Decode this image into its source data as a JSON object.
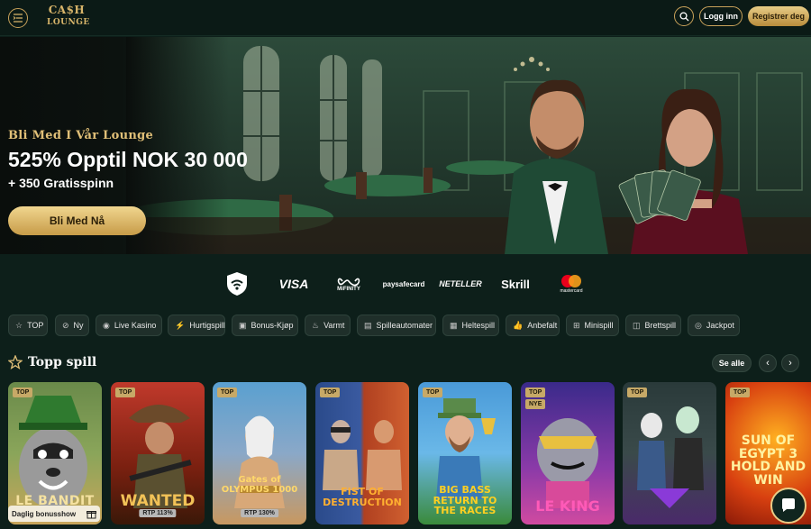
{
  "header": {
    "logo_line1": "CA$H",
    "logo_line2": "LOUNGE",
    "login_label": "Logg inn",
    "register_label": "Registrer deg"
  },
  "hero": {
    "eyebrow": "Bli Med I Vår Lounge",
    "title": "525% Opptil NOK 30 000",
    "subtitle": "+ 350 Gratisspinn",
    "cta_label": "Bli Med Nå",
    "slide_count": 3,
    "active_slide": 1
  },
  "payments": [
    "VISA",
    "MiFINITY",
    "paysafecard",
    "NETELLER",
    "Skrill",
    "mastercard"
  ],
  "categories": [
    {
      "label": "TOP",
      "icon": "star-icon"
    },
    {
      "label": "Ny",
      "icon": "new-icon"
    },
    {
      "label": "Live Kasino",
      "icon": "live-icon"
    },
    {
      "label": "Hurtigspill",
      "icon": "bolt-icon"
    },
    {
      "label": "Bonus-Kjøp",
      "icon": "gift-icon"
    },
    {
      "label": "Varmt",
      "icon": "flame-icon"
    },
    {
      "label": "Spilleautomater",
      "icon": "slot-icon"
    },
    {
      "label": "Heltespill",
      "icon": "hero-icon"
    },
    {
      "label": "Anbefalt",
      "icon": "thumbs-up-icon"
    },
    {
      "label": "Minispill",
      "icon": "mini-icon"
    },
    {
      "label": "Brettspill",
      "icon": "cards-icon"
    },
    {
      "label": "Jackpot",
      "icon": "jackpot-icon"
    }
  ],
  "section": {
    "title": "Topp spill",
    "see_all": "Se alle"
  },
  "games": [
    {
      "name": "LE BANDIT",
      "badges": [
        "TOP"
      ],
      "rtp": ""
    },
    {
      "name": "WANTED",
      "badges": [
        "TOP"
      ],
      "rtp": "RTP 113%"
    },
    {
      "name": "Gates of OLYMPUS 1000",
      "badges": [
        "TOP"
      ],
      "rtp": "RTP 130%"
    },
    {
      "name": "FIST OF DESTRUCTION",
      "badges": [
        "TOP"
      ],
      "rtp": ""
    },
    {
      "name": "BIG BASS RETURN TO THE RACES",
      "badges": [
        "TOP"
      ],
      "rtp": ""
    },
    {
      "name": "LE KING",
      "badges": [
        "TOP",
        "NYE"
      ],
      "rtp": ""
    },
    {
      "name": "",
      "badges": [
        "TOP"
      ],
      "rtp": ""
    },
    {
      "name": "SUN OF EGYPT 3 HOLD AND WIN",
      "badges": [
        "TOP"
      ],
      "rtp": ""
    }
  ],
  "bonus_show": "Daglig bonusshow"
}
